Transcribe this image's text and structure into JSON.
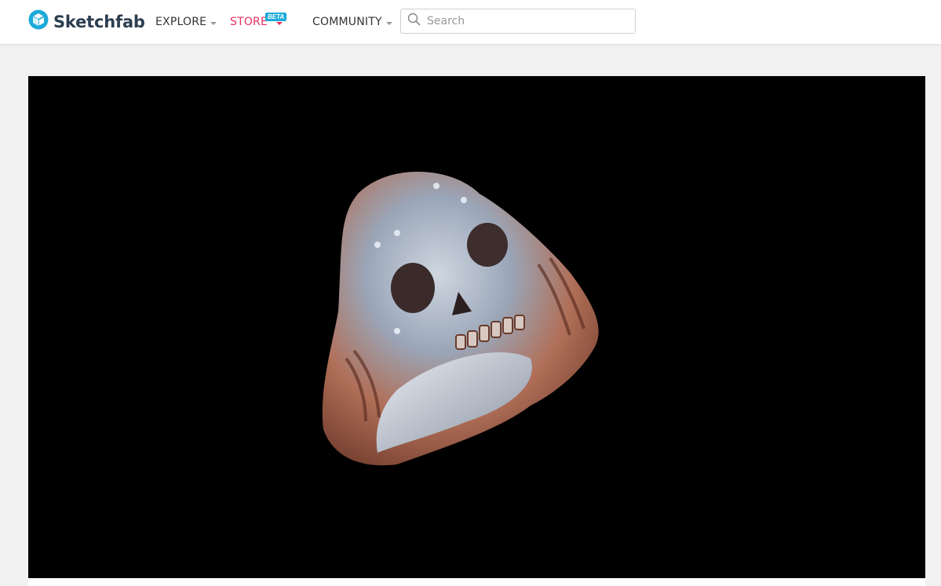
{
  "header": {
    "logo_text": "Sketchfab",
    "nav": {
      "explore": "EXPLORE",
      "store": "STORE",
      "store_badge": "BETA",
      "community": "COMMUNITY"
    },
    "search": {
      "placeholder": "Search",
      "value": ""
    }
  },
  "viewer": {
    "model_subject": "skull ring 3D model",
    "background": "#000000"
  },
  "colors": {
    "brand": "#1caad9",
    "store_accent": "#e7305f",
    "page_bg": "#f1f1f1"
  },
  "icons": [
    "sketchfab-logo-icon",
    "search-icon",
    "chevron-down-icon"
  ]
}
